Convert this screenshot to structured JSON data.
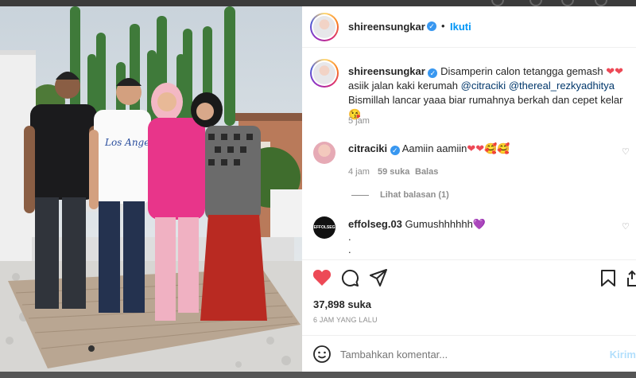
{
  "post": {
    "author": "shireensungkar",
    "follow_label": "Ikuti",
    "separator": "•",
    "more_label": "···",
    "caption": {
      "username": "shireensungkar",
      "text_1": "Disamperin calon tetangga gemash",
      "hearts_1": "❤❤",
      "text_2": "asiik jalan kaki kerumah",
      "mention_1": "@citraciki",
      "mention_2": "@thereal_rezkyadhitya",
      "text_3": "Bismillah lancar yaaa biar rumahnya berkah dan cepet kelar",
      "emoji_1": "😘",
      "time": "5 jam"
    },
    "comments": [
      {
        "username": "citraciki",
        "text": "Aamiin aamiin",
        "emoji": "❤❤🥰🥰",
        "time": "4 jam",
        "likes": "59 suka",
        "reply": "Balas",
        "view_replies": "Lihat balasan (1)"
      },
      {
        "username": "effolseg.03",
        "text": "Gumushhhhhh",
        "emoji": "💜",
        "extra_1": ".",
        "extra_2": ".",
        "avatar_text": "EFFOLSEG"
      }
    ],
    "like_count": "37,898 suka",
    "posted_ago": "6 JAM YANG LALU",
    "comment_placeholder": "Tambahkan komentar...",
    "send_label": "Kirim"
  },
  "colors": {
    "link": "#0095f6",
    "mention": "#00376b",
    "like_red": "#ed4956",
    "verified": "#3897f0"
  },
  "icons": [
    "like-heart-icon",
    "comment-icon",
    "share-icon",
    "bookmark-icon",
    "emoji-icon",
    "verified-icon",
    "more-icon"
  ]
}
